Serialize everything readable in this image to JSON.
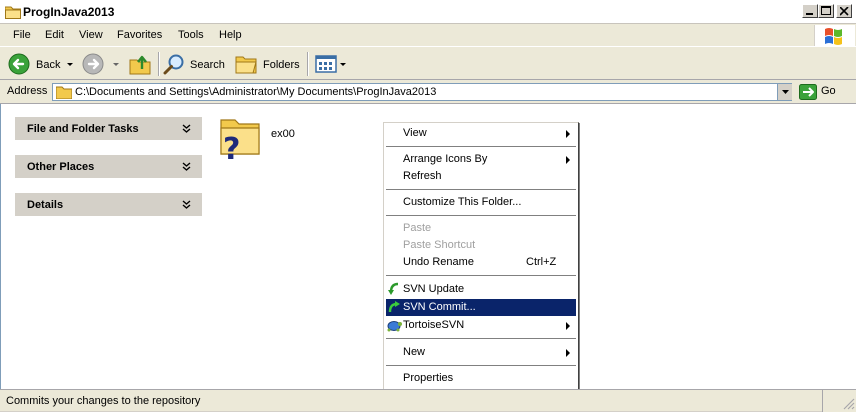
{
  "window": {
    "title": "ProgInJava2013"
  },
  "menubar": {
    "items": [
      "File",
      "Edit",
      "View",
      "Favorites",
      "Tools",
      "Help"
    ]
  },
  "toolbar": {
    "back_label": "Back",
    "search_label": "Search",
    "folders_label": "Folders"
  },
  "address": {
    "label": "Address",
    "value": "C:\\Documents and Settings\\Administrator\\My Documents\\ProgInJava2013",
    "go_label": "Go"
  },
  "tasks": {
    "panels": [
      {
        "title": "File and Folder Tasks"
      },
      {
        "title": "Other Places"
      },
      {
        "title": "Details"
      }
    ]
  },
  "files": [
    {
      "name": "ex00",
      "icon": "svn-conflicted-folder-icon"
    }
  ],
  "context_menu": {
    "items": [
      {
        "label": "View",
        "submenu": true
      },
      {
        "label": "Arrange Icons By",
        "submenu": true
      },
      {
        "label": "Refresh"
      },
      {
        "label": "Customize This Folder..."
      },
      {
        "label": "Paste",
        "disabled": true
      },
      {
        "label": "Paste Shortcut",
        "disabled": true
      },
      {
        "label": "Undo Rename",
        "shortcut": "Ctrl+Z"
      },
      {
        "label": "SVN Update",
        "icon": "svn-update-icon"
      },
      {
        "label": "SVN Commit...",
        "icon": "svn-commit-icon",
        "highlighted": true
      },
      {
        "label": "TortoiseSVN",
        "icon": "tortoisesvn-icon",
        "submenu": true
      },
      {
        "label": "New",
        "submenu": true
      },
      {
        "label": "Properties"
      }
    ]
  },
  "status": {
    "text": "Commits your changes to the repository"
  },
  "colors": {
    "highlight": "#0a246a",
    "panel": "#d4d0c8",
    "chrome": "#ece9d8"
  }
}
